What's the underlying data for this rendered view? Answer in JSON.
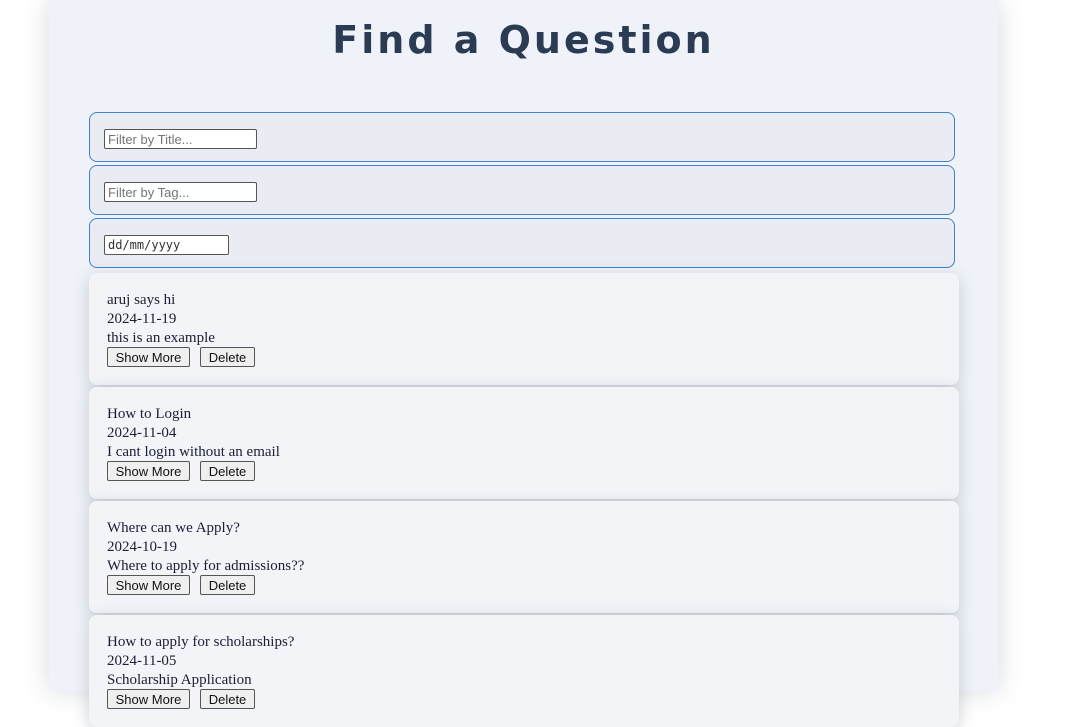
{
  "page": {
    "title": "Find a Question"
  },
  "filters": {
    "title_placeholder": "Filter by Title...",
    "tag_placeholder": "Filter by Tag...",
    "date_placeholder": "dd/mm/yyyy"
  },
  "questions": [
    {
      "title": "aruj says hi",
      "date": "2024-11-19",
      "body": "this is an example",
      "show_more_label": "Show More",
      "delete_label": "Delete"
    },
    {
      "title": "How to Login",
      "date": "2024-11-04",
      "body": "I cant login without an email",
      "show_more_label": "Show More",
      "delete_label": "Delete"
    },
    {
      "title": "Where can we Apply?",
      "date": "2024-10-19",
      "body": "Where to apply for admissions??",
      "show_more_label": "Show More",
      "delete_label": "Delete"
    },
    {
      "title": "How to apply for scholarships?",
      "date": "2024-11-05",
      "body": "Scholarship Application",
      "show_more_label": "Show More",
      "delete_label": "Delete"
    }
  ]
}
